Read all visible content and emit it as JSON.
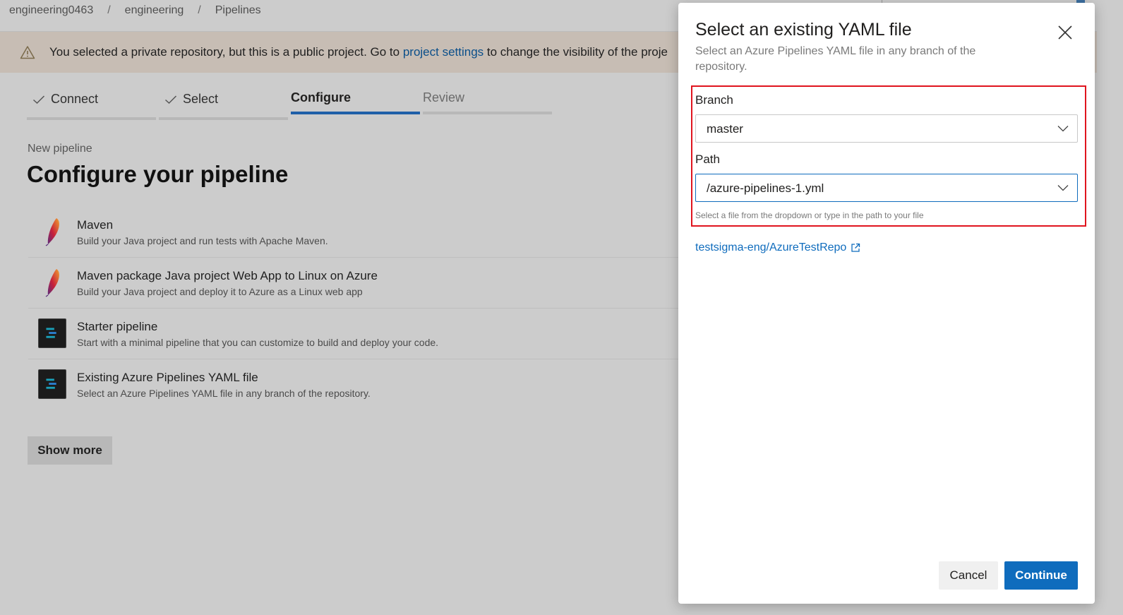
{
  "breadcrumb": {
    "org": "engineering0463",
    "sep1": "/",
    "project": "engineering",
    "sep2": "/",
    "page": "Pipelines"
  },
  "warning": {
    "text_before": "You selected a private repository, but this is a public project. Go to ",
    "link": "project settings",
    "text_after": " to change the visibility of the proje"
  },
  "stepper": {
    "steps": [
      {
        "label": "Connect",
        "state": "done"
      },
      {
        "label": "Select",
        "state": "done"
      },
      {
        "label": "Configure",
        "state": "active"
      },
      {
        "label": "Review",
        "state": "pending"
      }
    ]
  },
  "page": {
    "subtitle": "New pipeline",
    "title": "Configure your pipeline",
    "show_more": "Show more"
  },
  "templates": [
    {
      "name": "Maven",
      "desc": "Build your Java project and run tests with Apache Maven.",
      "icon": "apache-feather-icon"
    },
    {
      "name": "Maven package Java project Web App to Linux on Azure",
      "desc": "Build your Java project and deploy it to Azure as a Linux web app",
      "icon": "apache-feather-icon"
    },
    {
      "name": "Starter pipeline",
      "desc": "Start with a minimal pipeline that you can customize to build and deploy your code.",
      "icon": "pipeline-icon"
    },
    {
      "name": "Existing Azure Pipelines YAML file",
      "desc": "Select an Azure Pipelines YAML file in any branch of the repository.",
      "icon": "pipeline-icon"
    }
  ],
  "dialog": {
    "title": "Select an existing YAML file",
    "subtitle": "Select an Azure Pipelines YAML file in any branch of the repository.",
    "branch_label": "Branch",
    "branch_value": "master",
    "path_label": "Path",
    "path_value": "/azure-pipelines-1.yml",
    "hint": "Select a file from the dropdown or type in the path to your file",
    "repo_link": "testsigma-eng/AzureTestRepo",
    "cancel": "Cancel",
    "continue": "Continue"
  },
  "colors": {
    "accent": "#0f6cbd",
    "highlight": "#e0141e",
    "active_step": "#1f5fa8"
  }
}
